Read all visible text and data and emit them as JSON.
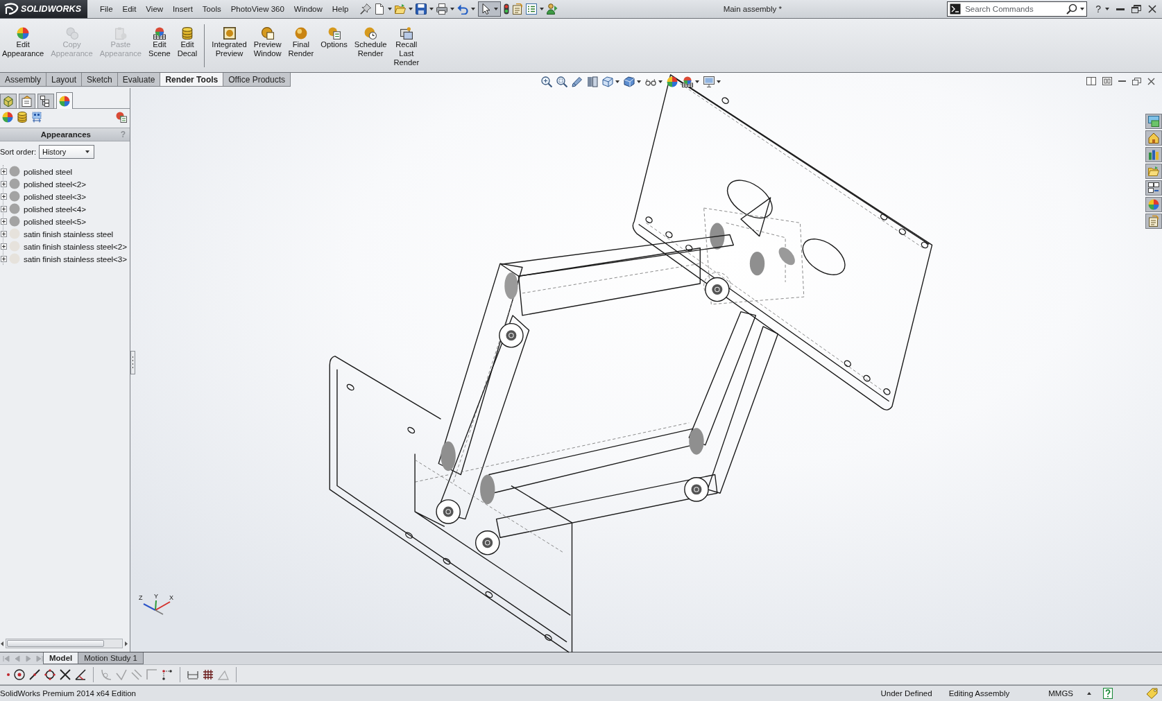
{
  "title_bar": {
    "logo_text": "SOLIDWORKS",
    "menu": [
      "File",
      "Edit",
      "View",
      "Insert",
      "Tools",
      "PhotoView 360",
      "Window",
      "Help"
    ],
    "select_pressed": true,
    "document_title": "Main assembly *",
    "search": {
      "placeholder": "Search Commands"
    },
    "help_glyph": "?"
  },
  "ribbon": {
    "buttons": [
      {
        "label": "Edit Appearance",
        "disabled": false
      },
      {
        "label": "Copy Appearance",
        "disabled": true
      },
      {
        "label": "Paste Appearance",
        "disabled": true
      },
      {
        "label": "Edit Scene",
        "disabled": false
      },
      {
        "label": "Edit Decal",
        "disabled": false
      },
      {
        "label": "Integrated Preview",
        "disabled": false
      },
      {
        "label": "Preview Window",
        "disabled": false
      },
      {
        "label": "Final Render",
        "disabled": false
      },
      {
        "label": "Options",
        "disabled": false
      },
      {
        "label": "Schedule Render",
        "disabled": false
      },
      {
        "label": "Recall Last Render",
        "disabled": false
      }
    ]
  },
  "command_tabs": [
    {
      "label": "Assembly",
      "selected": false
    },
    {
      "label": "Layout",
      "selected": false
    },
    {
      "label": "Sketch",
      "selected": false
    },
    {
      "label": "Evaluate",
      "selected": false
    },
    {
      "label": "Render Tools",
      "selected": true
    },
    {
      "label": "Office Products",
      "selected": false
    }
  ],
  "feature_manager": {
    "tabs": [
      {
        "selected": false
      },
      {
        "selected": false
      },
      {
        "selected": false
      },
      {
        "selected": true
      }
    ],
    "title": "Appearances",
    "help": "?",
    "sort_label": "Sort order:",
    "sort_value": "History",
    "items": [
      {
        "label": "polished steel",
        "color": "#a3a3a3",
        "expanded": false
      },
      {
        "label": "polished steel<2>",
        "color": "#a3a3a3",
        "expanded": false
      },
      {
        "label": "polished steel<3>",
        "color": "#a3a3a3",
        "expanded": false
      },
      {
        "label": "polished steel<4>",
        "color": "#a3a3a3",
        "expanded": false
      },
      {
        "label": "polished steel<5>",
        "color": "#a3a3a3",
        "expanded": false
      },
      {
        "label": "satin finish stainless steel",
        "color": "#e6e2dc",
        "expanded": false
      },
      {
        "label": "satin finish stainless steel<2>",
        "color": "#e6e2dc",
        "expanded": false
      },
      {
        "label": "satin finish stainless steel<3>",
        "color": "#e6e2dc",
        "expanded": false
      }
    ]
  },
  "viewport": {
    "triad_labels": [
      "Z",
      "Y",
      "X"
    ]
  },
  "bottom_tabs": {
    "nav_disabled": true,
    "tabs": [
      {
        "label": "Model",
        "selected": true
      },
      {
        "label": "Motion Study 1",
        "selected": false
      }
    ]
  },
  "sketch_tools": [
    {
      "disabled": false
    },
    {
      "disabled": false
    },
    {
      "disabled": false
    },
    {
      "disabled": false
    },
    {
      "disabled": false
    },
    {
      "disabled": false
    },
    {
      "disabled": true
    },
    {
      "disabled": true
    },
    {
      "disabled": true
    },
    {
      "disabled": true
    },
    {
      "disabled": false
    },
    {
      "disabled": false
    },
    {
      "disabled": false
    },
    {
      "disabled": true
    }
  ],
  "status_bar": {
    "product": "SolidWorks Premium 2014 x64 Edition",
    "fields": [
      "Under Defined",
      "Editing Assembly",
      "MMGS"
    ]
  }
}
